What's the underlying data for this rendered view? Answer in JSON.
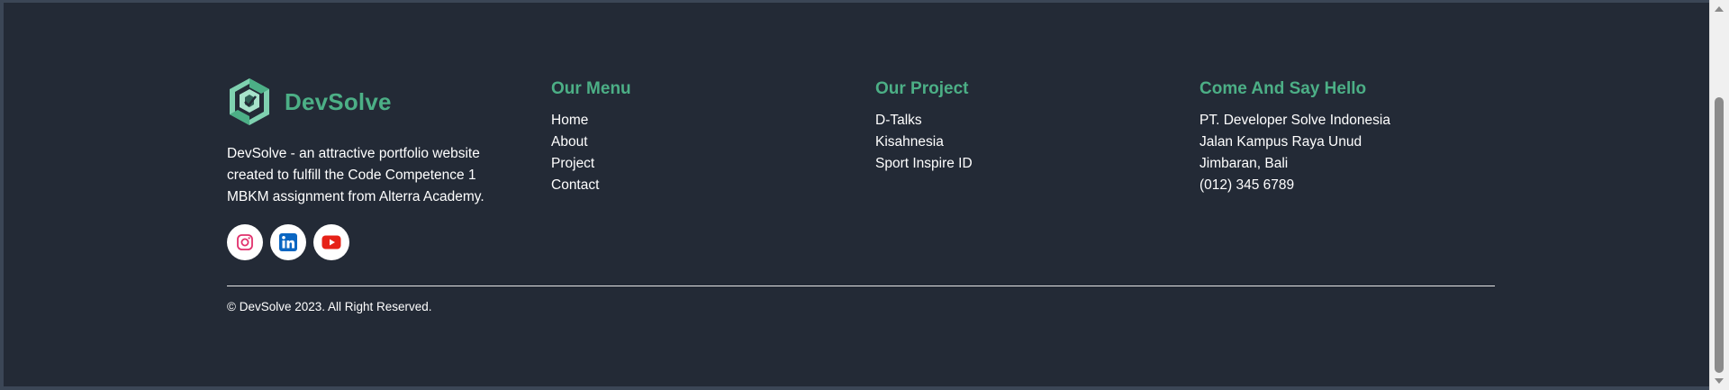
{
  "brand": {
    "name": "DevSolve",
    "description": "DevSolve - an attractive portfolio website created to fulfill the Code Competence 1 MBKM assignment from Alterra Academy."
  },
  "socials": [
    {
      "name": "instagram-icon",
      "color": "#e1306c"
    },
    {
      "name": "linkedin-icon",
      "color": "#0a66c2"
    },
    {
      "name": "youtube-icon",
      "color": "#e62117"
    }
  ],
  "menu": {
    "title": "Our Menu",
    "items": [
      "Home",
      "About",
      "Project",
      "Contact"
    ]
  },
  "project": {
    "title": "Our Project",
    "items": [
      "D-Talks",
      "Kisahnesia",
      "Sport Inspire ID"
    ]
  },
  "hello": {
    "title": "Come And Say Hello",
    "items": [
      "PT. Developer Solve Indonesia",
      "Jalan Kampus Raya Unud",
      "Jimbaran, Bali",
      "(012) 345 6789"
    ]
  },
  "copyright": "© DevSolve 2023. All Right Reserved.",
  "colors": {
    "background": "#232a36",
    "accent": "#4caf86",
    "text": "#ffffff"
  }
}
